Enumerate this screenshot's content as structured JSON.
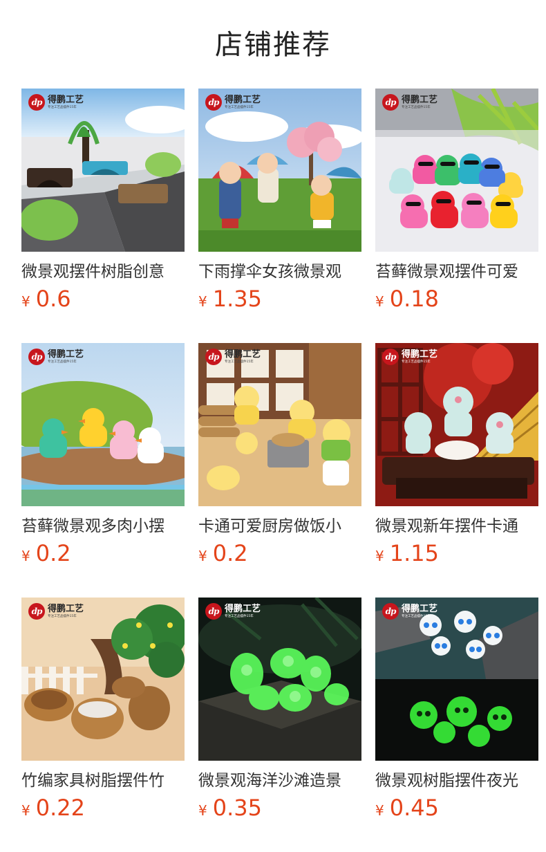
{
  "page": {
    "title": "店铺推荐"
  },
  "brand": {
    "name": "得鹏工艺",
    "logo_text": "dp",
    "sub": "专注工艺品摆件15年"
  },
  "currency": "¥",
  "products": [
    {
      "name": "微景观摆件树脂创意",
      "price": "0.6",
      "scene": "bridge"
    },
    {
      "name": "下雨撑伞女孩微景观",
      "price": "1.35",
      "scene": "umbrella"
    },
    {
      "name": "苔藓微景观摆件可爱",
      "price": "0.18",
      "scene": "ducks-sunglasses"
    },
    {
      "name": "苔藓微景观多肉小摆",
      "price": "0.2",
      "scene": "ducks"
    },
    {
      "name": "卡通可爱厨房做饭小",
      "price": "0.2",
      "scene": "kitchen"
    },
    {
      "name": "微景观新年摆件卡通",
      "price": "1.15",
      "scene": "dragon"
    },
    {
      "name": "竹编家具树脂摆件竹",
      "price": "0.22",
      "scene": "baskets"
    },
    {
      "name": "微景观海洋沙滩造景",
      "price": "0.35",
      "scene": "shells"
    },
    {
      "name": "微景观树脂摆件夜光",
      "price": "0.45",
      "scene": "ghosts"
    }
  ]
}
